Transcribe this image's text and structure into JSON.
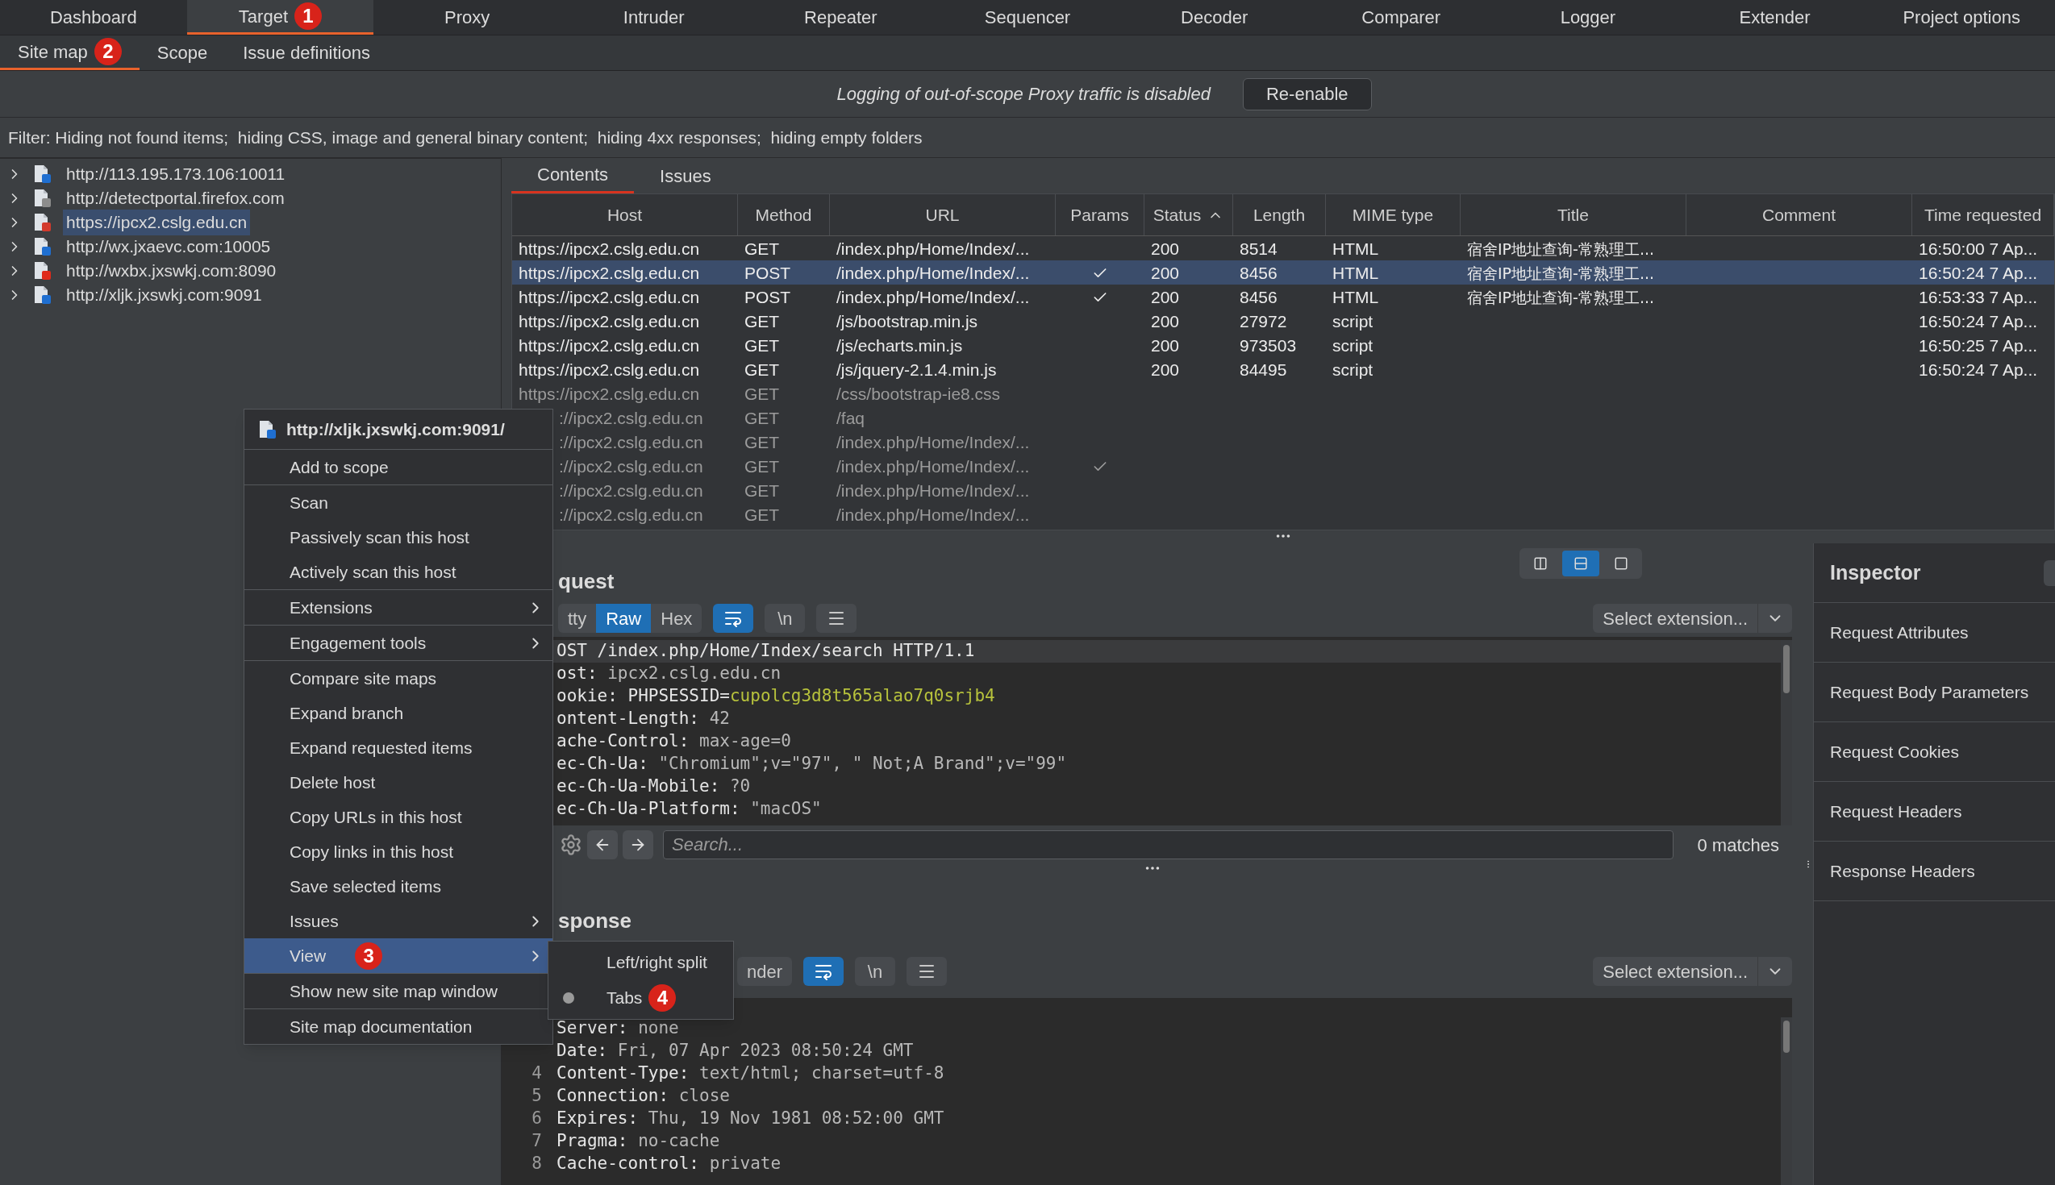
{
  "main_tabs": [
    {
      "label": "Dashboard",
      "selected": false
    },
    {
      "label": "Target",
      "selected": true,
      "badge": "1"
    },
    {
      "label": "Proxy",
      "selected": false
    },
    {
      "label": "Intruder",
      "selected": false
    },
    {
      "label": "Repeater",
      "selected": false
    },
    {
      "label": "Sequencer",
      "selected": false
    },
    {
      "label": "Decoder",
      "selected": false
    },
    {
      "label": "Comparer",
      "selected": false
    },
    {
      "label": "Logger",
      "selected": false
    },
    {
      "label": "Extender",
      "selected": false
    },
    {
      "label": "Project options",
      "selected": false
    }
  ],
  "sub_tabs": [
    {
      "label": "Site map",
      "selected": true,
      "badge": "2"
    },
    {
      "label": "Scope",
      "selected": false
    },
    {
      "label": "Issue definitions",
      "selected": false
    }
  ],
  "notice": {
    "text": "Logging of out-of-scope Proxy traffic is disabled",
    "button": "Re-enable"
  },
  "filter": "Filter: Hiding not found items;  hiding CSS, image and general binary content;  hiding 4xx responses;  hiding empty folders",
  "tree": [
    {
      "label": "http://113.195.173.106:10011",
      "color": "#1f6fd1",
      "selected": false
    },
    {
      "label": "http://detectportal.firefox.com",
      "color": "#8c8c8c",
      "selected": false
    },
    {
      "label": "https://ipcx2.cslg.edu.cn",
      "color": "#d33a2c",
      "selected": true
    },
    {
      "label": "http://wx.jxaevc.com:10005",
      "color": "#1f6fd1",
      "selected": false
    },
    {
      "label": "http://wxbx.jxswkj.com:8090",
      "color": "#e02a1a",
      "selected": false
    },
    {
      "label": "http://xljk.jxswkj.com:9091",
      "color": "#1f6fd1",
      "selected": false
    }
  ],
  "content_tabs": [
    {
      "label": "Contents",
      "selected": true
    },
    {
      "label": "Issues",
      "selected": false
    }
  ],
  "table": {
    "columns": [
      {
        "label": "Host"
      },
      {
        "label": "Method"
      },
      {
        "label": "URL"
      },
      {
        "label": "Params"
      },
      {
        "label": "Status",
        "sorted": true
      },
      {
        "label": "Length"
      },
      {
        "label": "MIME type"
      },
      {
        "label": "Title"
      },
      {
        "label": "Comment"
      },
      {
        "label": "Time requested"
      }
    ],
    "rows": [
      {
        "host": "https://ipcx2.cslg.edu.cn",
        "method": "GET",
        "url": "/index.php/Home/Index/...",
        "params": false,
        "status": "200",
        "length": "8514",
        "mime": "HTML",
        "title": "宿舍IP地址查询-常熟理工...",
        "time": "16:50:00 7 Ap...",
        "selected": false,
        "requested": true,
        "covered": false
      },
      {
        "host": "https://ipcx2.cslg.edu.cn",
        "method": "POST",
        "url": "/index.php/Home/Index/...",
        "params": true,
        "status": "200",
        "length": "8456",
        "mime": "HTML",
        "title": "宿舍IP地址查询-常熟理工...",
        "time": "16:50:24 7 Ap...",
        "selected": true,
        "requested": true,
        "covered": false
      },
      {
        "host": "https://ipcx2.cslg.edu.cn",
        "method": "POST",
        "url": "/index.php/Home/Index/...",
        "params": true,
        "status": "200",
        "length": "8456",
        "mime": "HTML",
        "title": "宿舍IP地址查询-常熟理工...",
        "time": "16:53:33 7 Ap...",
        "selected": false,
        "requested": true,
        "covered": false
      },
      {
        "host": "https://ipcx2.cslg.edu.cn",
        "method": "GET",
        "url": "/js/bootstrap.min.js",
        "params": false,
        "status": "200",
        "length": "27972",
        "mime": "script",
        "time": "16:50:24 7 Ap...",
        "selected": false,
        "requested": true,
        "covered": false
      },
      {
        "host": "https://ipcx2.cslg.edu.cn",
        "method": "GET",
        "url": "/js/echarts.min.js",
        "params": false,
        "status": "200",
        "length": "973503",
        "mime": "script",
        "time": "16:50:25 7 Ap...",
        "selected": false,
        "requested": true,
        "covered": false
      },
      {
        "host": "https://ipcx2.cslg.edu.cn",
        "method": "GET",
        "url": "/js/jquery-2.1.4.min.js",
        "params": false,
        "status": "200",
        "length": "84495",
        "mime": "script",
        "time": "16:50:24 7 Ap...",
        "selected": false,
        "requested": true,
        "covered": false
      },
      {
        "host": "https://ipcx2.cslg.edu.cn",
        "method": "GET",
        "url": "/css/bootstrap-ie8.css",
        "params": false,
        "selected": false,
        "requested": false,
        "covered": false
      },
      {
        "host": "://ipcx2.cslg.edu.cn",
        "method": "GET",
        "url": "/faq",
        "params": false,
        "selected": false,
        "requested": false,
        "covered": true
      },
      {
        "host": "://ipcx2.cslg.edu.cn",
        "method": "GET",
        "url": "/index.php/Home/Index/...",
        "params": false,
        "selected": false,
        "requested": false,
        "covered": true
      },
      {
        "host": "://ipcx2.cslg.edu.cn",
        "method": "GET",
        "url": "/index.php/Home/Index/...",
        "params": true,
        "selected": false,
        "requested": false,
        "covered": true
      },
      {
        "host": "://ipcx2.cslg.edu.cn",
        "method": "GET",
        "url": "/index.php/Home/Index/...",
        "params": false,
        "selected": false,
        "requested": false,
        "covered": true
      },
      {
        "host": "://ipcx2.cslg.edu.cn",
        "method": "GET",
        "url": "/index.php/Home/Index/...",
        "params": false,
        "selected": false,
        "requested": false,
        "covered": true
      }
    ]
  },
  "layout_buttons": [
    {
      "kind": "columns",
      "selected": false
    },
    {
      "kind": "rows",
      "selected": true
    },
    {
      "kind": "single",
      "selected": false
    }
  ],
  "request": {
    "title": "quest",
    "view_tabs": [
      {
        "label": "tty",
        "selected": false
      },
      {
        "label": "Raw",
        "selected": true
      },
      {
        "label": "Hex",
        "selected": false
      }
    ],
    "tools": [
      {
        "kind": "wrap",
        "selected": true
      },
      {
        "kind": "newlines",
        "label": "\\n",
        "selected": false
      },
      {
        "kind": "menu",
        "selected": false
      }
    ],
    "extension": "Select extension...",
    "lines": [
      {
        "current": true,
        "parts": [
          {
            "text": "OST /index.php/Home/Index/search HTTP/1.1",
            "kind": "name"
          }
        ]
      },
      {
        "current": false,
        "parts": [
          {
            "text": "ost: ",
            "kind": "name"
          },
          {
            "text": "ipcx2.cslg.edu.cn",
            "kind": "value"
          }
        ]
      },
      {
        "current": false,
        "parts": [
          {
            "text": "ookie: ",
            "kind": "name"
          },
          {
            "text": "PHPSESSID=",
            "kind": "name"
          },
          {
            "text": "cupolcg3d8t565alao7q0srjb4",
            "kind": "cookie"
          }
        ]
      },
      {
        "current": false,
        "parts": [
          {
            "text": "ontent-Length: ",
            "kind": "name"
          },
          {
            "text": "42",
            "kind": "value"
          }
        ]
      },
      {
        "current": false,
        "parts": [
          {
            "text": "ache-Control: ",
            "kind": "name"
          },
          {
            "text": "max-age=0",
            "kind": "value"
          }
        ]
      },
      {
        "current": false,
        "parts": [
          {
            "text": "ec-Ch-Ua: ",
            "kind": "name"
          },
          {
            "text": "\"Chromium\";v=\"97\", \" Not;A Brand\";v=\"99\"",
            "kind": "value"
          }
        ]
      },
      {
        "current": false,
        "parts": [
          {
            "text": "ec-Ch-Ua-Mobile: ",
            "kind": "name"
          },
          {
            "text": "?0",
            "kind": "value"
          }
        ]
      },
      {
        "current": false,
        "parts": [
          {
            "text": "ec-Ch-Ua-Platform: ",
            "kind": "name"
          },
          {
            "text": "\"macOS\"",
            "kind": "value"
          }
        ]
      }
    ],
    "search_placeholder": "Search...",
    "matches": "0 matches"
  },
  "response": {
    "title": "sponse",
    "view_tabs": [
      {
        "label": "nder",
        "selected": false
      }
    ],
    "tools": [
      {
        "kind": "wrap",
        "selected": true
      },
      {
        "kind": "newlines",
        "label": "\\n",
        "selected": false
      },
      {
        "kind": "menu",
        "selected": false
      }
    ],
    "extension": "Select extension...",
    "lines": [
      {
        "parts": [
          {
            "text": "Server: ",
            "kind": "name"
          },
          {
            "text": "none",
            "kind": "value"
          }
        ]
      },
      {
        "parts": [
          {
            "text": "Date: ",
            "kind": "name"
          },
          {
            "text": "Fri, 07 Apr 2023 08:50:24 GMT",
            "kind": "value"
          }
        ]
      },
      {
        "number": "4",
        "parts": [
          {
            "text": "Content-Type: ",
            "kind": "name"
          },
          {
            "text": "text/html; charset=utf-8",
            "kind": "value"
          }
        ]
      },
      {
        "number": "5",
        "parts": [
          {
            "text": "Connection: ",
            "kind": "name"
          },
          {
            "text": "close",
            "kind": "value"
          }
        ]
      },
      {
        "number": "6",
        "parts": [
          {
            "text": "Expires: ",
            "kind": "name"
          },
          {
            "text": "Thu, 19 Nov 1981 08:52:00 GMT",
            "kind": "value"
          }
        ]
      },
      {
        "number": "7",
        "parts": [
          {
            "text": "Pragma: ",
            "kind": "name"
          },
          {
            "text": "no-cache",
            "kind": "value"
          }
        ]
      },
      {
        "number": "8",
        "parts": [
          {
            "text": "Cache-control: ",
            "kind": "name"
          },
          {
            "text": "private",
            "kind": "value"
          }
        ]
      }
    ]
  },
  "inspector": {
    "title": "Inspector",
    "items": [
      "Request Attributes",
      "Request Body Parameters",
      "Request Cookies",
      "Request Headers",
      "Response Headers"
    ]
  },
  "context_menu": {
    "header": "http://xljk.jxswkj.com:9091/",
    "groups": [
      [
        {
          "label": "Add to scope",
          "submenu": false,
          "selected": false
        }
      ],
      [
        {
          "label": "Scan",
          "submenu": false,
          "selected": false
        },
        {
          "label": "Passively scan this host",
          "submenu": false,
          "selected": false
        },
        {
          "label": "Actively scan this host",
          "submenu": false,
          "selected": false
        }
      ],
      [
        {
          "label": "Extensions",
          "submenu": true,
          "selected": false
        }
      ],
      [
        {
          "label": "Engagement tools",
          "submenu": true,
          "selected": false
        }
      ],
      [
        {
          "label": "Compare site maps",
          "submenu": false,
          "selected": false
        },
        {
          "label": "Expand branch",
          "submenu": false,
          "selected": false
        },
        {
          "label": "Expand requested items",
          "submenu": false,
          "selected": false
        },
        {
          "label": "Delete host",
          "submenu": false,
          "selected": false
        },
        {
          "label": "Copy URLs in this host",
          "submenu": false,
          "selected": false
        },
        {
          "label": "Copy links in this host",
          "submenu": false,
          "selected": false
        },
        {
          "label": "Save selected items",
          "submenu": false,
          "selected": false
        },
        {
          "label": "Issues",
          "submenu": true,
          "selected": false
        },
        {
          "label": "View",
          "submenu": true,
          "selected": true,
          "badge": "3"
        }
      ],
      [
        {
          "label": "Show new site map window",
          "submenu": false,
          "selected": false
        }
      ],
      [
        {
          "label": "Site map documentation",
          "submenu": false,
          "selected": false
        }
      ]
    ]
  },
  "submenu": [
    {
      "label": "Left/right split",
      "selected": false
    },
    {
      "label": "Tabs",
      "selected": true,
      "badge": "4"
    }
  ]
}
